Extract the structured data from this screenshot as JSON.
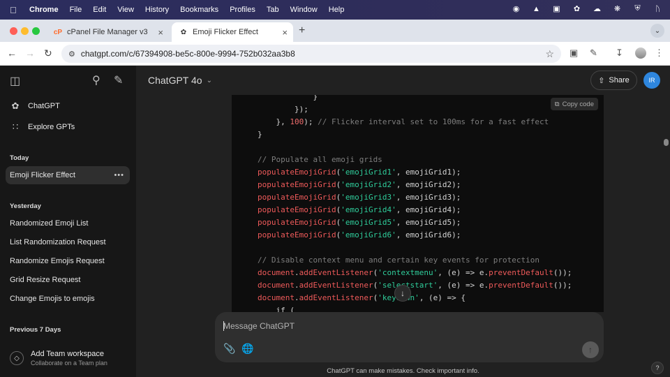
{
  "menubar": {
    "app": "Chrome",
    "items": [
      "File",
      "Edit",
      "View",
      "History",
      "Bookmarks",
      "Profiles",
      "Tab",
      "Window",
      "Help"
    ]
  },
  "tabs": [
    {
      "title": "cPanel File Manager v3",
      "icon": "cpanel-icon"
    },
    {
      "title": "Emoji Flicker Effect",
      "icon": "openai-icon",
      "active": true
    }
  ],
  "address": {
    "url": "chatgpt.com/c/67394908-be5c-800e-9994-752b032aa3b8"
  },
  "sidebar": {
    "nav": [
      {
        "label": "ChatGPT",
        "icon": "openai-icon"
      },
      {
        "label": "Explore GPTs",
        "icon": "grid-icon"
      }
    ],
    "today_label": "Today",
    "today": [
      {
        "label": "Emoji Flicker Effect",
        "active": true
      }
    ],
    "yesterday_label": "Yesterday",
    "yesterday": [
      {
        "label": "Randomized Emoji List"
      },
      {
        "label": "List Randomization Request"
      },
      {
        "label": "Randomize Emojis Request"
      },
      {
        "label": "Grid Resize Request"
      },
      {
        "label": "Change Emojis to emojis"
      }
    ],
    "prev7_label": "Previous 7 Days",
    "team": {
      "title": "Add Team workspace",
      "subtitle": "Collaborate on a Team plan"
    }
  },
  "header": {
    "model": "ChatGPT 4o",
    "share": "Share",
    "avatar": "IR"
  },
  "code": {
    "copy_label": "Copy code",
    "lines": [
      [
        {
          "t": "            }",
          "c": ""
        }
      ],
      [
        {
          "t": "        });",
          "c": ""
        }
      ],
      [
        {
          "t": "    }, ",
          "c": ""
        },
        {
          "t": "100",
          "c": "num"
        },
        {
          "t": "); ",
          "c": ""
        },
        {
          "t": "// Flicker interval set to 100ms for a fast effect",
          "c": "com"
        }
      ],
      [
        {
          "t": "}",
          "c": ""
        }
      ],
      [
        {
          "t": "",
          "c": ""
        }
      ],
      [
        {
          "t": "// Populate all emoji grids",
          "c": "com"
        }
      ],
      [
        {
          "t": "populateEmojiGrid",
          "c": "red"
        },
        {
          "t": "(",
          "c": ""
        },
        {
          "t": "'emojiGrid1'",
          "c": "str"
        },
        {
          "t": ", emojiGrid1);",
          "c": ""
        }
      ],
      [
        {
          "t": "populateEmojiGrid",
          "c": "red"
        },
        {
          "t": "(",
          "c": ""
        },
        {
          "t": "'emojiGrid2'",
          "c": "str"
        },
        {
          "t": ", emojiGrid2);",
          "c": ""
        }
      ],
      [
        {
          "t": "populateEmojiGrid",
          "c": "red"
        },
        {
          "t": "(",
          "c": ""
        },
        {
          "t": "'emojiGrid3'",
          "c": "str"
        },
        {
          "t": ", emojiGrid3);",
          "c": ""
        }
      ],
      [
        {
          "t": "populateEmojiGrid",
          "c": "red"
        },
        {
          "t": "(",
          "c": ""
        },
        {
          "t": "'emojiGrid4'",
          "c": "str"
        },
        {
          "t": ", emojiGrid4);",
          "c": ""
        }
      ],
      [
        {
          "t": "populateEmojiGrid",
          "c": "red"
        },
        {
          "t": "(",
          "c": ""
        },
        {
          "t": "'emojiGrid5'",
          "c": "str"
        },
        {
          "t": ", emojiGrid5);",
          "c": ""
        }
      ],
      [
        {
          "t": "populateEmojiGrid",
          "c": "red"
        },
        {
          "t": "(",
          "c": ""
        },
        {
          "t": "'emojiGrid6'",
          "c": "str"
        },
        {
          "t": ", emojiGrid6);",
          "c": ""
        }
      ],
      [
        {
          "t": "",
          "c": ""
        }
      ],
      [
        {
          "t": "// Disable context menu and certain key events for protection",
          "c": "com"
        }
      ],
      [
        {
          "t": "document",
          "c": "red"
        },
        {
          "t": ".",
          "c": ""
        },
        {
          "t": "addEventListener",
          "c": "red"
        },
        {
          "t": "(",
          "c": ""
        },
        {
          "t": "'contextmenu'",
          "c": "str"
        },
        {
          "t": ", (e) => e.",
          "c": ""
        },
        {
          "t": "preventDefault",
          "c": "red"
        },
        {
          "t": "());",
          "c": ""
        }
      ],
      [
        {
          "t": "document",
          "c": "red"
        },
        {
          "t": ".",
          "c": ""
        },
        {
          "t": "addEventListener",
          "c": "red"
        },
        {
          "t": "(",
          "c": ""
        },
        {
          "t": "'selectstart'",
          "c": "str"
        },
        {
          "t": ", (e) => e.",
          "c": ""
        },
        {
          "t": "preventDefault",
          "c": "red"
        },
        {
          "t": "());",
          "c": ""
        }
      ],
      [
        {
          "t": "document",
          "c": "red"
        },
        {
          "t": ".",
          "c": ""
        },
        {
          "t": "addEventListener",
          "c": "red"
        },
        {
          "t": "(",
          "c": ""
        },
        {
          "t": "'keydown'",
          "c": "str"
        },
        {
          "t": ", (e) => {",
          "c": ""
        }
      ],
      [
        {
          "t": "    if (",
          "c": ""
        }
      ]
    ]
  },
  "composer": {
    "placeholder": "Message ChatGPT"
  },
  "disclaimer": "ChatGPT can make mistakes. Check important info.",
  "help": "?"
}
